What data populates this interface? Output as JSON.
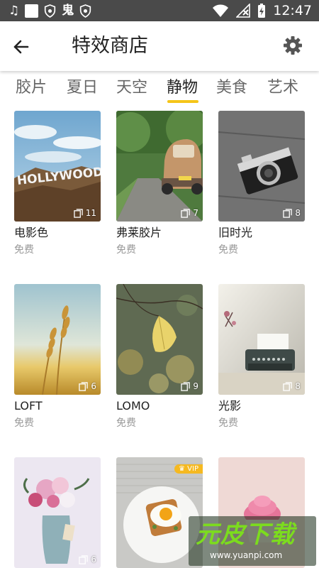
{
  "status_bar": {
    "time": "12:47",
    "left_icons": [
      "music-note-icon",
      "square-icon",
      "shield-icon",
      "ghost-app-icon",
      "shield-icon"
    ],
    "right_icons": [
      "wifi-icon",
      "no-signal-icon",
      "battery-charging-icon"
    ]
  },
  "app_bar": {
    "title": "特效商店"
  },
  "tabs": [
    {
      "label": "胶片",
      "active": false
    },
    {
      "label": "夏日",
      "active": false
    },
    {
      "label": "天空",
      "active": false
    },
    {
      "label": "静物",
      "active": true
    },
    {
      "label": "美食",
      "active": false
    },
    {
      "label": "艺术",
      "active": false
    }
  ],
  "cards": [
    {
      "title": "电影色",
      "price": "免费",
      "count": "11",
      "art": "hollywood-sign"
    },
    {
      "title": "弗莱胶片",
      "price": "免费",
      "count": "7",
      "art": "vintage-car"
    },
    {
      "title": "旧时光",
      "price": "免费",
      "count": "8",
      "art": "camera"
    },
    {
      "title": "LOFT",
      "price": "免费",
      "count": "6",
      "art": "wheat"
    },
    {
      "title": "LOMO",
      "price": "免费",
      "count": "9",
      "art": "leaf"
    },
    {
      "title": "光影",
      "price": "免费",
      "count": "8",
      "art": "typewriter"
    },
    {
      "title": "",
      "price": "",
      "count": "6",
      "art": "flower-vase"
    },
    {
      "title": "",
      "price": "",
      "count": "",
      "art": "egg-toast",
      "badge": "VIP"
    },
    {
      "title": "",
      "price": "",
      "count": "",
      "art": "cake"
    }
  ],
  "watermark": {
    "main": "元皮下载",
    "sub": "www.yuanpi.com"
  },
  "colors": {
    "accent": "#f5c518",
    "status_bar": "#4a4a4a",
    "vip": "#f5b921"
  }
}
